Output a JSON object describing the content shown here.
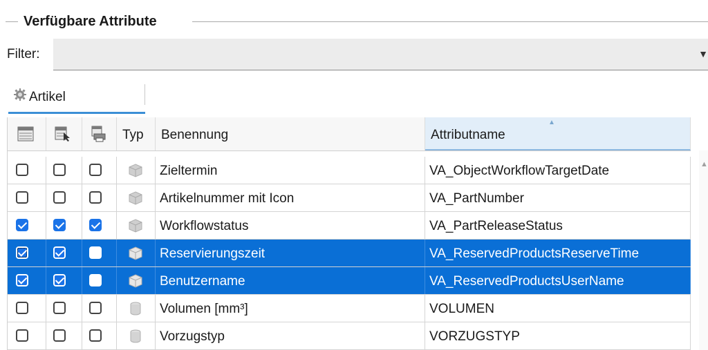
{
  "group_title": "Verfügbare Attribute",
  "filter": {
    "label": "Filter:",
    "value": ""
  },
  "tabs": [
    {
      "label": "Artikel",
      "icon": "gear-icon",
      "active": true
    }
  ],
  "table": {
    "columns": [
      "",
      "",
      "",
      "Typ",
      "Benennung",
      "Attributname"
    ],
    "header_icons": [
      "column-layout-icon",
      "select-column-icon",
      "print-column-icon"
    ],
    "sorted_column": "Attributname",
    "rows": [
      {
        "c1": false,
        "c2": false,
        "c3": false,
        "type_icon": "cube-icon",
        "benennung": "Zieltermin",
        "attributname": "VA_ObjectWorkflowTargetDate",
        "selected": false
      },
      {
        "c1": false,
        "c2": false,
        "c3": false,
        "type_icon": "cube-icon",
        "benennung": "Artikelnummer mit Icon",
        "attributname": "VA_PartNumber",
        "selected": false
      },
      {
        "c1": true,
        "c2": true,
        "c3": true,
        "type_icon": "cube-icon",
        "benennung": "Workflowstatus",
        "attributname": "VA_PartReleaseStatus",
        "selected": false
      },
      {
        "c1": true,
        "c2": true,
        "c3": false,
        "type_icon": "cube-icon",
        "benennung": "Reservierungszeit",
        "attributname": "VA_ReservedProductsReserveTime",
        "selected": true
      },
      {
        "c1": true,
        "c2": true,
        "c3": false,
        "type_icon": "cube-icon",
        "benennung": "Benutzername",
        "attributname": "VA_ReservedProductsUserName",
        "selected": true
      },
      {
        "c1": false,
        "c2": false,
        "c3": false,
        "type_icon": "database-icon",
        "benennung": "Volumen [mm³]",
        "attributname": "VOLUMEN",
        "selected": false
      },
      {
        "c1": false,
        "c2": false,
        "c3": false,
        "type_icon": "database-icon",
        "benennung": "Vorzugstyp",
        "attributname": "VORZUGSTYP",
        "selected": false
      }
    ]
  },
  "colors": {
    "selection": "#0a6fd6",
    "checkbox_on": "#1a73e8",
    "accent": "#3b8fd6"
  }
}
